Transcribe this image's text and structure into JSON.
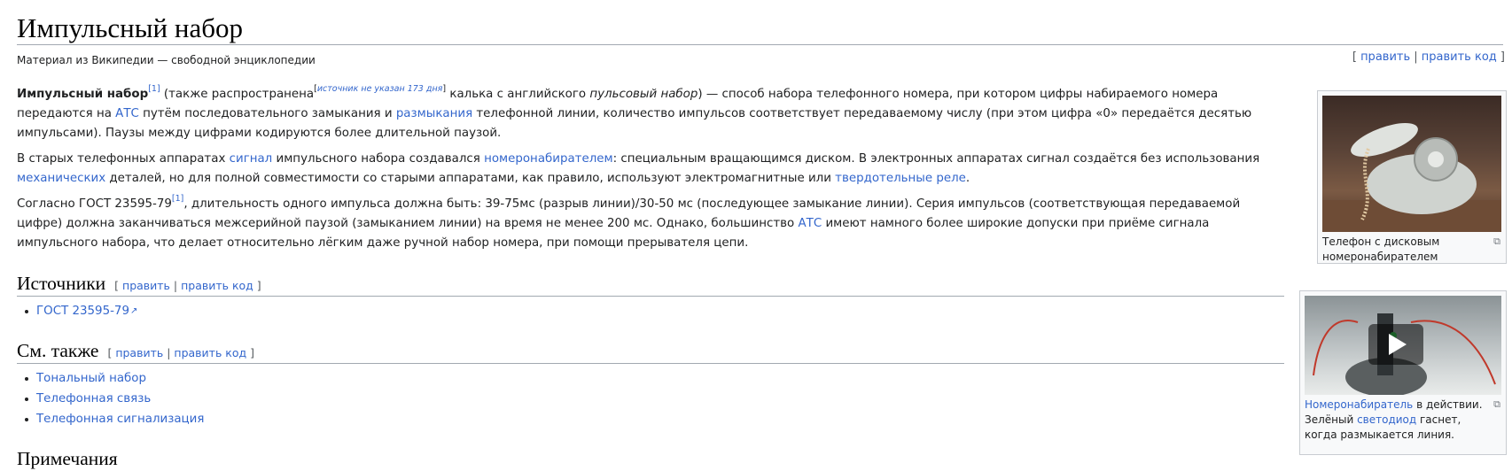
{
  "page": {
    "title": "Импульсный набор",
    "tagline": "Материал из Википедии — свободной энциклопедии",
    "edit_links": {
      "open": "[ ",
      "edit": "править",
      "sep": " | ",
      "edit_code": "править код",
      "close": " ]"
    }
  },
  "body": {
    "p1": {
      "term": "Импульсный набор",
      "ref1": "[1]",
      "t1": " (также распространена",
      "cn_open": "[",
      "cn_text": "источник не указан 173 дня",
      "cn_close": "]",
      "t2": " калька с английского ",
      "t2_italic": "пульсовый набор",
      "t3": ") — способ набора телефонного номера, при котором цифры набираемого номера передаются на ",
      "link_ats": "АТС",
      "t4": " путём последовательного замыкания и ",
      "link_razmyk": "размыкания",
      "t5": " телефонной линии, количество импульсов соответствует передаваемому числу (при этом цифра «0» передаётся десятью импульсами). Паузы между цифрами кодируются более длительной паузой."
    },
    "p2": {
      "t1": "В старых телефонных аппаратах ",
      "link_signal": "сигнал",
      "t2": " импульсного набора создавался ",
      "link_nomerator": "номеронабирателем",
      "t3": ": специальным вращающимся диском. В электронных аппаратах сигнал создаётся без использования ",
      "link_mech": "механических",
      "t4": " деталей, но для полной совместимости со старыми аппаратами, как правило, используют электромагнитные или ",
      "link_rele": "твердотельные реле",
      "t5": "."
    },
    "p3": {
      "t1": "Согласно ГОСТ 23595-79",
      "ref1": "[1]",
      "t2": ", длительность одного импульса должна быть: 39-75мс (разрыв линии)/30-50 мс (последующее замыкание линии). Серия импульсов (соответствующая передаваемой цифре) должна заканчиваться межсерийной паузой (замыканием линии) на время не менее 200 мс. Однако, большинство ",
      "link_ats": "АТС",
      "t3": " имеют намного более широкие допуски при приёме сигнала импульсного набора, что делает относительно лёгким даже ручной набор номера, при помощи прерывателя цепи."
    }
  },
  "sections": {
    "sources": {
      "title": "Источники",
      "items": [
        "ГОСТ 23595-79"
      ]
    },
    "see_also": {
      "title": "См. также",
      "items": [
        "Тональный набор",
        "Телефонная связь",
        "Телефонная сигнализация"
      ]
    },
    "notes": {
      "title": "Примечания"
    }
  },
  "section_edit": {
    "open": "[ ",
    "edit": "править",
    "sep": " | ",
    "edit_code": "править код",
    "close": " ]"
  },
  "figures": {
    "fig1": {
      "caption": "Телефон с дисковым номеронабирателем"
    },
    "fig2": {
      "cap_link1": "Номеронабиратель",
      "cap_t1": " в действии. Зелёный ",
      "cap_link2": "светодиод",
      "cap_t2": " гаснет, когда размыкается линия."
    }
  },
  "icons": {
    "external_link": "external-link-icon",
    "enlarge": "enlarge-icon",
    "play": "play-icon"
  },
  "colors": {
    "link": "#3366cc",
    "text": "#202122",
    "rule": "#a2a9b1"
  }
}
